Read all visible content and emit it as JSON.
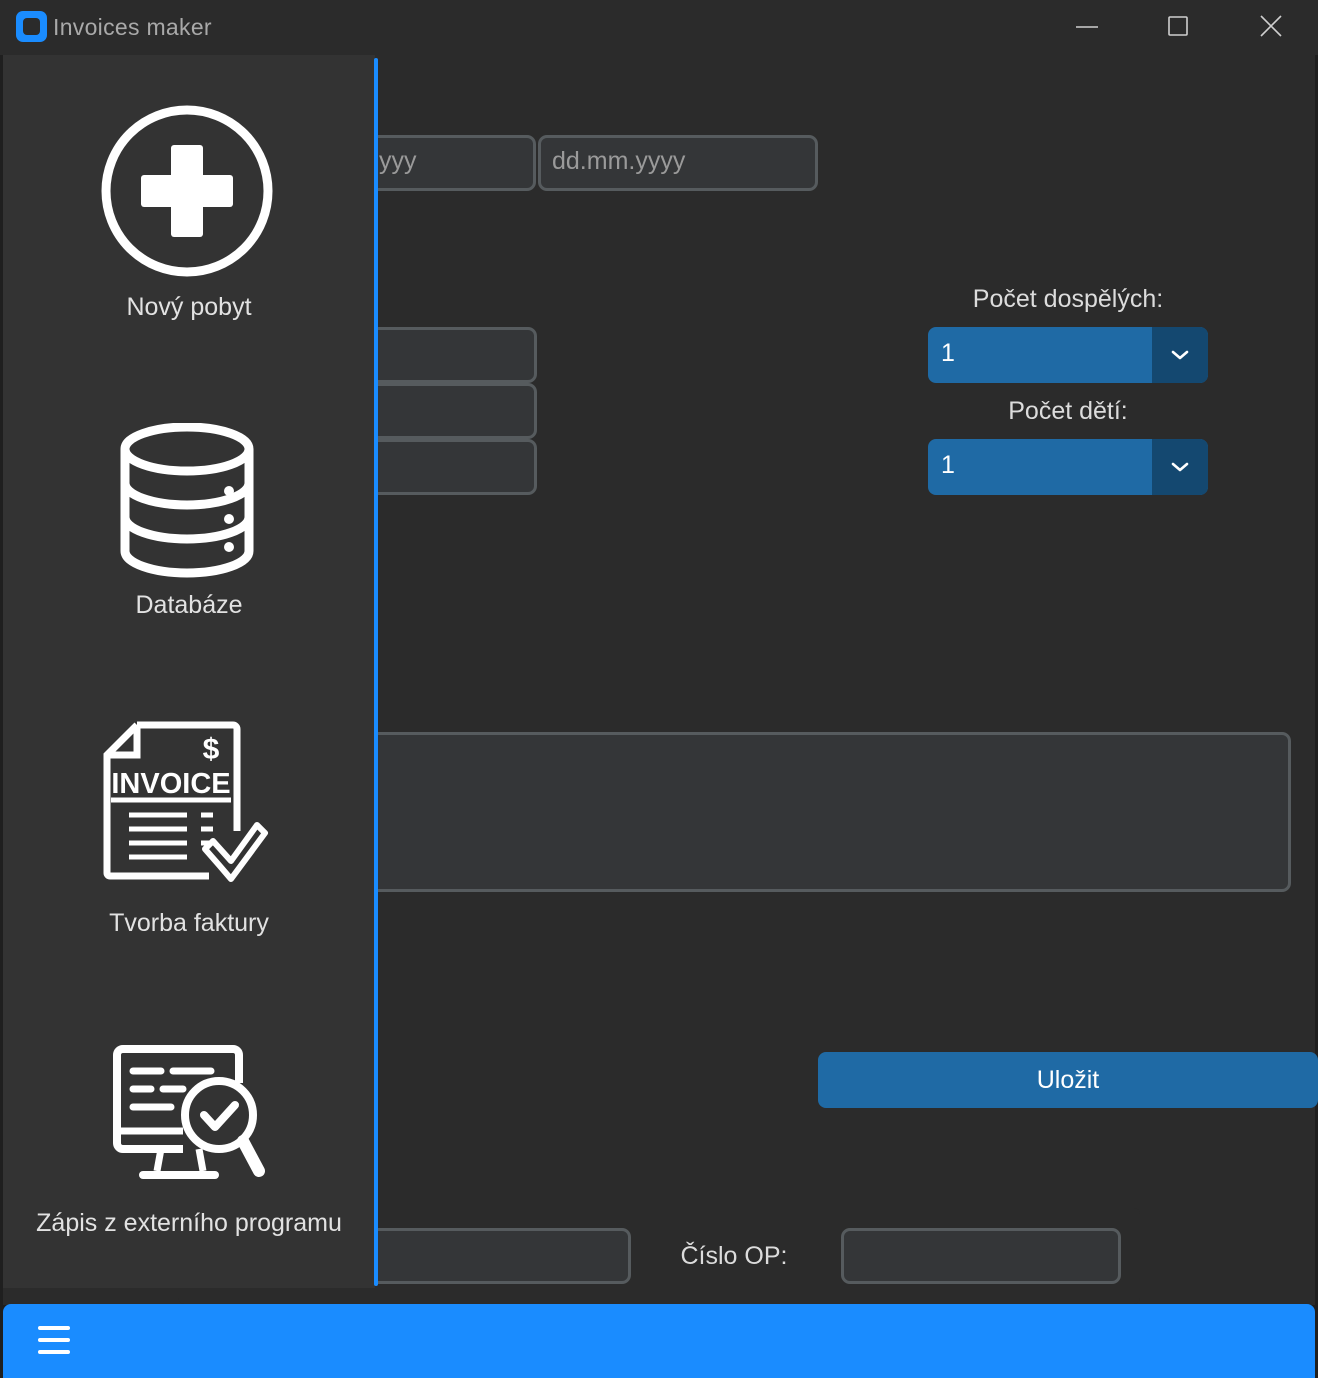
{
  "window": {
    "title": "Invoices maker",
    "minimize_icon": "minimize-icon",
    "maximize_icon": "maximize-icon",
    "close_icon": "close-icon"
  },
  "form": {
    "date_from_visible_text": "yyy",
    "date_to_placeholder": "dd.mm.yyyy",
    "adults_label": "Počet dospělých:",
    "adults_value": "1",
    "children_label": "Počet dětí:",
    "children_value": "1",
    "save_label": "Uložit",
    "id_card_label": "Číslo OP:"
  },
  "sidebar": {
    "items": [
      {
        "label": "Nový pobyt",
        "icon": "plus-circle-icon"
      },
      {
        "label": "Databáze",
        "icon": "database-icon"
      },
      {
        "label": "Tvorba faktury",
        "icon": "invoice-icon",
        "icon_text": "INVOICE",
        "icon_symbol": "$"
      },
      {
        "label": "Zápis z externího programu",
        "icon": "monitor-search-icon"
      }
    ]
  },
  "bottombar": {
    "menu_icon": "hamburger-menu-icon"
  },
  "colors": {
    "accent": "#1a8cff",
    "button": "#1f6aa5",
    "button_dark": "#144870",
    "background": "#2b2b2b",
    "sidebar": "#333333",
    "entry_bg": "#343638",
    "entry_border": "#565b5e"
  }
}
